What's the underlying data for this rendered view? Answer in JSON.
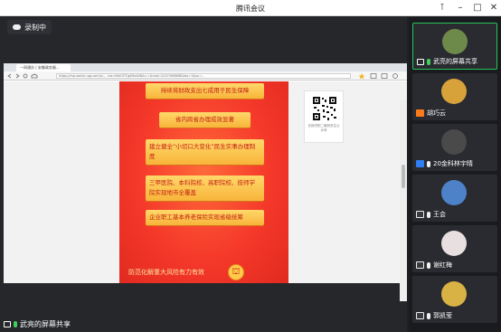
{
  "window": {
    "title": "腾讯会议",
    "controls": [
      "pin-icon",
      "minimize-icon",
      "maximize-icon",
      "close-icon"
    ]
  },
  "recording": {
    "label": "录制中",
    "icon": "cloud-icon"
  },
  "browser": {
    "tab_title": "一网通办 | 安徽政务服...",
    "url": "https://mp.weixin.qq.com/s/.... biz=MzIOOTg0MzA0NA==&mid=2247496806&idx=1&sn=..."
  },
  "poster": {
    "items": [
      "持续将财政支出七成用于民生保障",
      "省内跨省办理成效显著",
      "建立健全“小切口大变化”民生实事办理制度",
      "三甲医院、本科院校、高职院校、技师学院实现地市全覆盖",
      "企业职工基本养老保险实现省级统筹"
    ],
    "footer": "防范化解重大风险有力有效"
  },
  "qr_card": {
    "caption": "长按识别二维码关注公众号"
  },
  "share_label": "武亮的屏幕共享",
  "participants": [
    {
      "name": "武亮的屏幕共享",
      "avatar_color": "#6e8a4a",
      "badge": "screen-icon"
    },
    {
      "name": "胡巧云",
      "avatar_color": "#d8a23a",
      "badge": "user-icon"
    },
    {
      "name": "20金科林宇晴",
      "avatar_color": "#4a4a4a",
      "badge": "user-icon"
    },
    {
      "name": "王会",
      "avatar_color": "#4d82c9",
      "badge": "screen-icon"
    },
    {
      "name": "谢红梅",
      "avatar_color": "#e8e0e0",
      "badge": "screen-icon"
    },
    {
      "name": "郭凯莹",
      "avatar_color": "#d9b245",
      "badge": "screen-icon"
    }
  ]
}
